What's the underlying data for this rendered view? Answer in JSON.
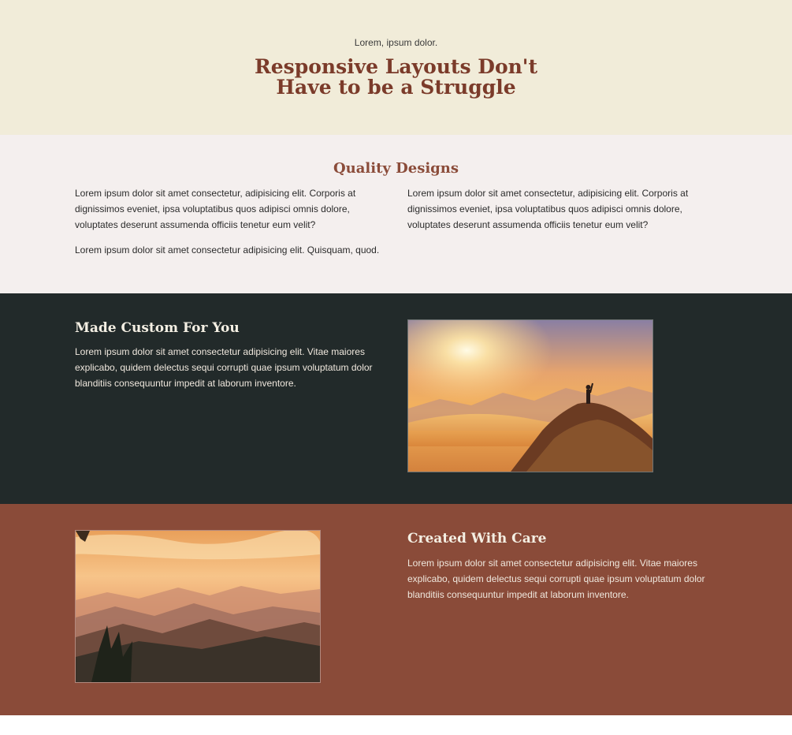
{
  "hero": {
    "eyebrow": "Lorem, ipsum dolor.",
    "title": "Responsive Layouts Don't Have to be a Struggle"
  },
  "quality": {
    "heading": "Quality Designs",
    "col1": "Lorem ipsum dolor sit amet consectetur, adipisicing elit. Corporis at dignissimos eveniet, ipsa voluptatibus quos adipisci omnis dolore, voluptates deserunt assumenda officiis tenetur eum velit?",
    "col2": "Lorem ipsum dolor sit amet consectetur, adipisicing elit. Corporis at dignissimos eveniet, ipsa voluptatibus quos adipisci omnis dolore, voluptates deserunt assumenda officiis tenetur eum velit?",
    "extra": "Lorem ipsum dolor sit amet consectetur adipisicing elit. Quisquam, quod."
  },
  "custom": {
    "heading": "Made Custom For You",
    "body": "Lorem ipsum dolor sit amet consectetur adipisicing elit. Vitae maiores explicabo, quidem delectus sequi corrupti quae ipsum voluptatum dolor blanditiis consequuntur impedit at laborum inventore."
  },
  "care": {
    "heading": "Created With Care",
    "body": "Lorem ipsum dolor sit amet consectetur adipisicing elit. Vitae maiores explicabo, quidem delectus sequi corrupti quae ipsum voluptatum dolor blanditiis consequuntur impedit at laborum inventore."
  },
  "colors": {
    "hero_bg": "#f1ecd9",
    "quality_bg": "#f4efee",
    "custom_bg": "#222a2a",
    "care_bg": "#8a4b39",
    "title_brown": "#7b3b2a"
  }
}
